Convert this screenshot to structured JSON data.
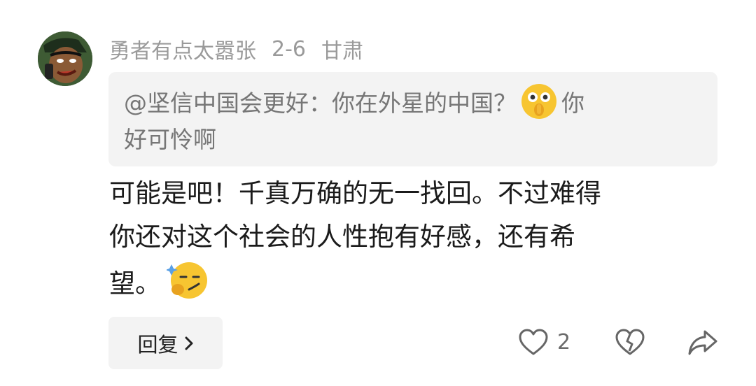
{
  "comment": {
    "username": "勇者有点太嚣张",
    "date": "2-6",
    "location": "甘肃",
    "quote": {
      "prefix": "@坚信中国会更好：你在外星的中国？",
      "suffix_line1": "你",
      "suffix_line2": "好可怜啊",
      "emoji": "shushing-face-emoji"
    },
    "body": {
      "line1": "可能是吧！千真万确的无一找回。不过难得",
      "line2": "你还对这个社会的人性抱有好感，还有希",
      "line3": "望。",
      "emoji": "smug-thinking-face-emoji"
    }
  },
  "actions": {
    "reply_label": "回复",
    "like_count": "2",
    "icons": [
      "heart-icon",
      "broken-heart-icon",
      "share-icon"
    ]
  },
  "colors": {
    "meta_text": "#9a9a9a",
    "quote_bg": "#f3f3f3",
    "body_text": "#1b1b1b"
  }
}
